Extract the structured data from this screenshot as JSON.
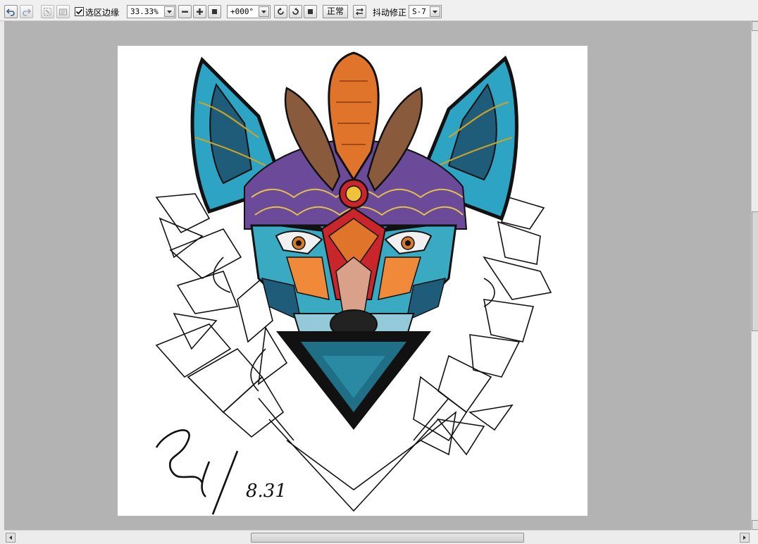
{
  "toolbar": {
    "icons": [
      "undo-icon",
      "redo-icon",
      "deselect-icon",
      "clear-icon",
      "zoom-out-icon",
      "zoom-in-icon",
      "zoom-fit-icon",
      "rotate-ccw-icon",
      "rotate-cw-icon",
      "rotate-reset-icon",
      "flip-icon"
    ],
    "selection_edge_checked": true,
    "selection_edge_label": "选区边缘",
    "zoom_value": "33.33%",
    "rotation_value": "+000°",
    "normal_label": "正常",
    "stabilizer_label": "抖动修正",
    "stabilizer_value": "S-7"
  },
  "canvas": {
    "signature_date": "8.31"
  },
  "colors": {
    "workspace": "#b3b3b3",
    "toolbar": "#f0f0f0",
    "paper": "#ffffff",
    "teal": "#2ea4c4",
    "orange": "#e0742a",
    "brown": "#8a5a3c",
    "red": "#c8262a"
  }
}
